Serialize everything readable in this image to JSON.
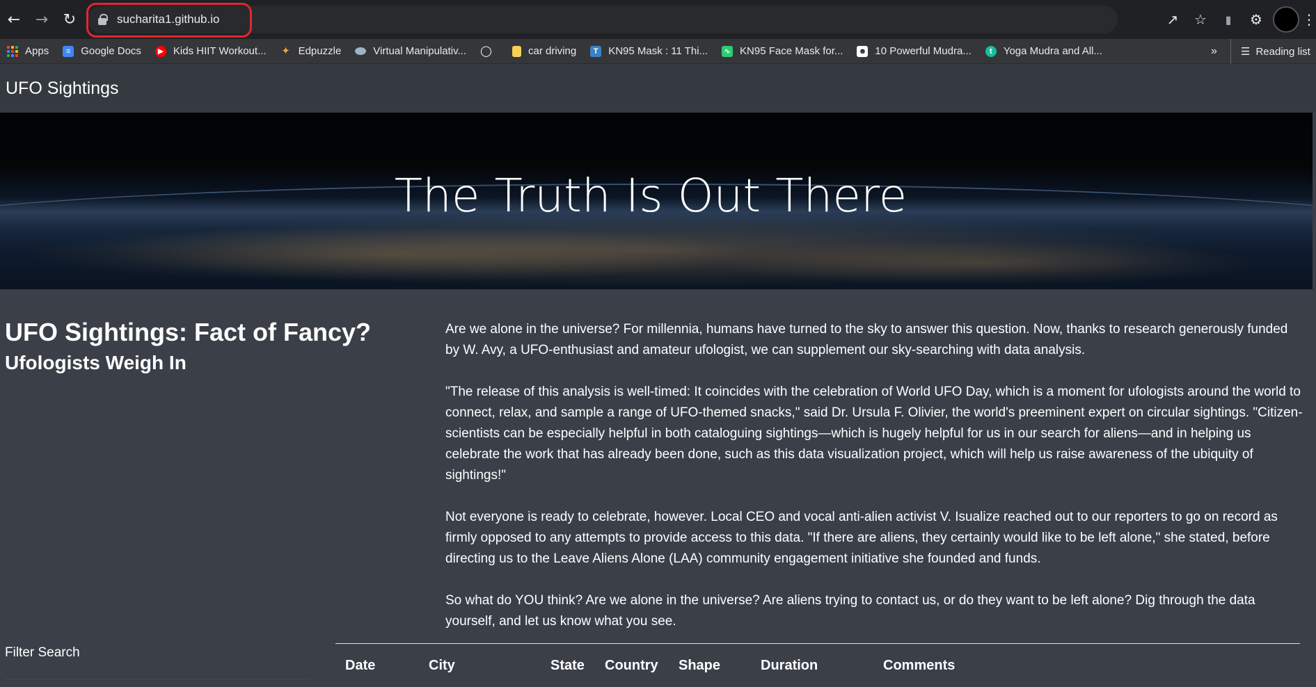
{
  "browser": {
    "url": "sucharita1.github.io",
    "nav": {
      "back_icon": "arrow-left-icon",
      "forward_icon": "arrow-right-icon",
      "reload_icon": "reload-icon"
    },
    "bookmarks": [
      {
        "label": "Apps",
        "icon": "apps-grid-icon"
      },
      {
        "label": "Google Docs",
        "icon": "google-docs-icon",
        "color": "#4285f4"
      },
      {
        "label": "Kids HIIT Workout...",
        "icon": "youtube-icon",
        "color": "#ff0000"
      },
      {
        "label": "Edpuzzle",
        "icon": "edpuzzle-icon",
        "color": "#f5a623"
      },
      {
        "label": "Virtual Manipulativ...",
        "icon": "manipulatives-icon",
        "color": "#9fb3c8"
      },
      {
        "label": "",
        "icon": "globe-icon"
      },
      {
        "label": "car driving",
        "icon": "folder-icon",
        "color": "#f7d154"
      },
      {
        "label": "KN95 Mask : 11 Thi...",
        "icon": "kn95-icon",
        "color": "#3b82c4"
      },
      {
        "label": "KN95 Face Mask for...",
        "icon": "pulse-icon",
        "color": "#2ecc71"
      },
      {
        "label": "10 Powerful Mudra...",
        "icon": "mudra-icon",
        "color": "#ffffff"
      },
      {
        "label": "Yoga Mudra and All...",
        "icon": "yoga-icon",
        "color": "#1abc9c"
      }
    ],
    "more_label": "»",
    "reading_list_label": "Reading list"
  },
  "site": {
    "brand": "UFO Sightings",
    "hero_title": "The Truth Is Out There",
    "headline": "UFO Sightings: Fact of Fancy?",
    "subheadline": "Ufologists Weigh In",
    "paragraphs": [
      "Are we alone in the universe? For millennia, humans have turned to the sky to answer this question. Now, thanks to research generously funded by W. Avy, a UFO-enthusiast and amateur ufologist, we can supplement our sky-searching with data analysis.",
      "\"The release of this analysis is well-timed: It coincides with the celebration of World UFO Day, which is a moment for ufologists around the world to connect, relax, and sample a range of UFO-themed snacks,\" said Dr. Ursula F. Olivier, the world's preeminent expert on circular sightings. \"Citizen-scientists can be especially helpful in both cataloguing sightings—which is hugely helpful for us in our search for aliens—and in helping us celebrate the work that has already been done, such as this data visualization project, which will help us raise awareness of the ubiquity of sightings!\"",
      "Not everyone is ready to celebrate, however. Local CEO and vocal anti-alien activist V. Isualize reached out to our reporters to go on record as firmly opposed to any attempts to provide access to this data. \"If there are aliens, they certainly would like to be left alone,\" she stated, before directing us to the Leave Aliens Alone (LAA) community engagement initiative she founded and funds.",
      "So what do YOU think? Are we alone in the universe? Are aliens trying to contact us, or do they want to be left alone? Dig through the data yourself, and let us know what you see."
    ],
    "filter_label": "Filter Search",
    "table": {
      "columns": [
        "Date",
        "City",
        "State",
        "Country",
        "Shape",
        "Duration",
        "Comments"
      ]
    }
  }
}
